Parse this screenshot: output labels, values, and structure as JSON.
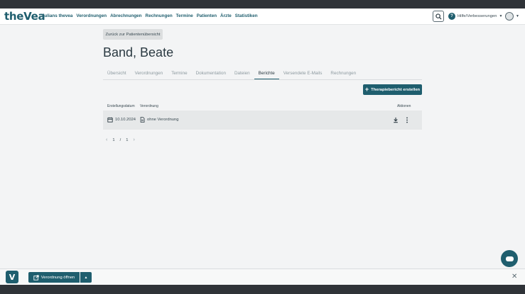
{
  "nav": {
    "logo": "theVea",
    "menu": [
      "Julians thevea",
      "Verordnungen",
      "Abrechnungen",
      "Rechnungen",
      "Termine",
      "Patienten",
      "Ärzte",
      "Statistiken"
    ],
    "help_label": "Hilfe/Verbesserungen",
    "help_glyph": "?"
  },
  "back_button": "Zurück zur Patientenübersicht",
  "patient_name": "Band, Beate",
  "tabs": [
    "Übersicht",
    "Verordnungen",
    "Termine",
    "Dokumentation",
    "Dateien",
    "Berichte",
    "Versendete E-Mails",
    "Rechnungen"
  ],
  "active_tab": "Berichte",
  "create_button": "Therapiebericht erstellen",
  "table": {
    "headers": [
      "Erstellungsdatum",
      "Verordnung",
      "Aktionen"
    ],
    "rows": [
      {
        "date": "10.10.2024",
        "verordnung": "ohne Verordnung"
      }
    ]
  },
  "pagination": {
    "current": "1",
    "separator": "/",
    "total": "1"
  },
  "bottom_bar": {
    "logo_glyph": "V",
    "open_button": "Verordnung öffnen"
  },
  "colors": {
    "accent": "#1f5e6e",
    "background": "#f3f4f5"
  }
}
